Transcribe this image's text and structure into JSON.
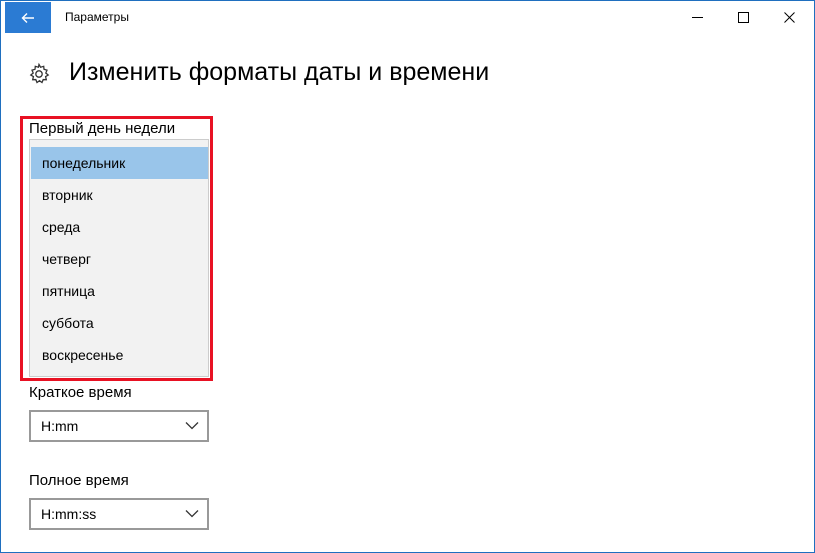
{
  "window": {
    "title": "Параметры",
    "back_icon": "arrow-left-icon",
    "controls": [
      "minimize-icon",
      "maximize-icon",
      "close-icon"
    ]
  },
  "page": {
    "title": "Изменить форматы даты и времени",
    "icon": "gear-icon"
  },
  "first_day": {
    "label": "Первый день недели",
    "options": [
      "понедельник",
      "вторник",
      "среда",
      "четверг",
      "пятница",
      "суббота",
      "воскресенье"
    ],
    "selected": "понедельник"
  },
  "short_time": {
    "label": "Краткое время",
    "value": "H:mm"
  },
  "long_time": {
    "label": "Полное время",
    "value": "H:mm:ss"
  },
  "colors": {
    "accent": "#2b7bd3",
    "selection": "#99c5ea",
    "highlight_border": "#e81123"
  }
}
